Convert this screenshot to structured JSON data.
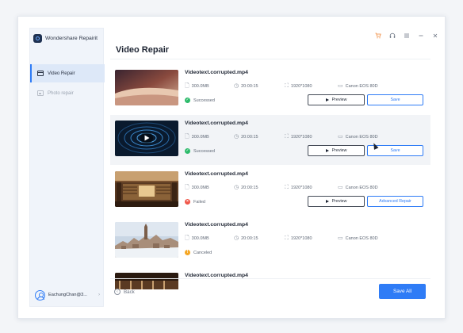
{
  "app": {
    "name": "Wondershare Repairit"
  },
  "window_controls": {
    "cart_icon": "cart-icon",
    "support_icon": "headset-icon",
    "menu_icon": "menu-icon",
    "minimize_icon": "minimize-icon",
    "close_icon": "close-icon"
  },
  "sidebar": {
    "items": [
      {
        "label": "Video Repair",
        "icon": "video-icon",
        "active": true
      },
      {
        "label": "Photo repair",
        "icon": "photo-icon",
        "active": false
      }
    ],
    "user": {
      "name": "EachungChan@3...",
      "chevron": "›"
    }
  },
  "page": {
    "title": "Video Repair"
  },
  "files": [
    {
      "name": "Videotext.corrupted.mp4",
      "size": "300.0MB",
      "duration": "20:00:15",
      "resolution": "1920*1080",
      "camera": "Canon EOS 80D",
      "status": "Successed",
      "status_color": "#2dbb6b",
      "status_symbol": "✓",
      "actions": [
        "Preview",
        "Save"
      ],
      "thumb": "dune",
      "highlighted": false
    },
    {
      "name": "Videotext.corrupted.mp4",
      "size": "300.0MB",
      "duration": "20:00:15",
      "resolution": "1920*1080",
      "camera": "Canon EOS 80D",
      "status": "Successed",
      "status_color": "#2dbb6b",
      "status_symbol": "✓",
      "actions": [
        "Preview",
        "Save"
      ],
      "thumb": "waves",
      "highlighted": true
    },
    {
      "name": "Videotext.corrupted.mp4",
      "size": "300.0MB",
      "duration": "20:00:15",
      "resolution": "1920*1080",
      "camera": "Canon EOS 80D",
      "status": "Failed",
      "status_color": "#f0574a",
      "status_symbol": "×",
      "actions": [
        "Preview",
        "Advanced Repair"
      ],
      "thumb": "library",
      "highlighted": false
    },
    {
      "name": "Videotext.corrupted.mp4",
      "size": "300.0MB",
      "duration": "20:00:15",
      "resolution": "1920*1080",
      "camera": "Canon EOS 80D",
      "status": "Canceled",
      "status_color": "#f5a623",
      "status_symbol": "!",
      "actions": [],
      "thumb": "town",
      "highlighted": false
    },
    {
      "name": "Videotext.corrupted.mp4",
      "size": "",
      "duration": "",
      "resolution": "",
      "camera": "",
      "status": "",
      "status_color": "#2dbb6b",
      "status_symbol": "",
      "actions": [],
      "thumb": "library",
      "highlighted": false
    }
  ],
  "footer": {
    "back_label": "Back",
    "save_all_label": "Save All"
  }
}
